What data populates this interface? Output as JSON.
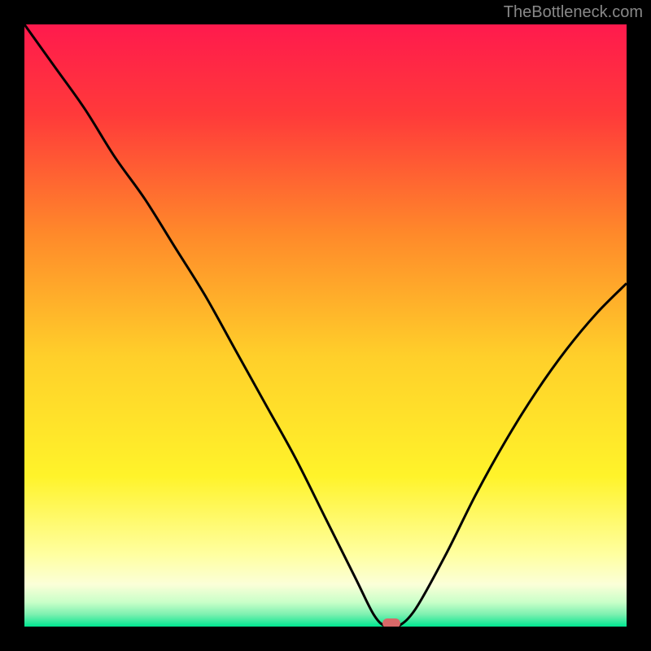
{
  "watermark": "TheBottleneck.com",
  "chart_data": {
    "type": "line",
    "title": "",
    "xlabel": "",
    "ylabel": "",
    "xlim": [
      0,
      100
    ],
    "ylim": [
      0,
      100
    ],
    "x": [
      0,
      5,
      10,
      15,
      20,
      25,
      30,
      35,
      40,
      45,
      50,
      55,
      58,
      60,
      62,
      65,
      70,
      75,
      80,
      85,
      90,
      95,
      100
    ],
    "values": [
      100,
      93,
      86,
      78,
      71,
      63,
      55,
      46,
      37,
      28,
      18,
      8,
      2,
      0,
      0,
      3,
      12,
      22,
      31,
      39,
      46,
      52,
      57
    ],
    "minimum_point": {
      "x": 61,
      "y": 0
    },
    "gradient_stops": [
      {
        "pos": 0.0,
        "color": "#ff1a4d"
      },
      {
        "pos": 0.15,
        "color": "#ff3a3a"
      },
      {
        "pos": 0.35,
        "color": "#ff8a2a"
      },
      {
        "pos": 0.55,
        "color": "#ffcf2a"
      },
      {
        "pos": 0.75,
        "color": "#fff32a"
      },
      {
        "pos": 0.88,
        "color": "#ffffa0"
      },
      {
        "pos": 0.93,
        "color": "#fbffd8"
      },
      {
        "pos": 0.96,
        "color": "#c8ffc8"
      },
      {
        "pos": 0.98,
        "color": "#7cf0b0"
      },
      {
        "pos": 1.0,
        "color": "#00e690"
      }
    ]
  }
}
